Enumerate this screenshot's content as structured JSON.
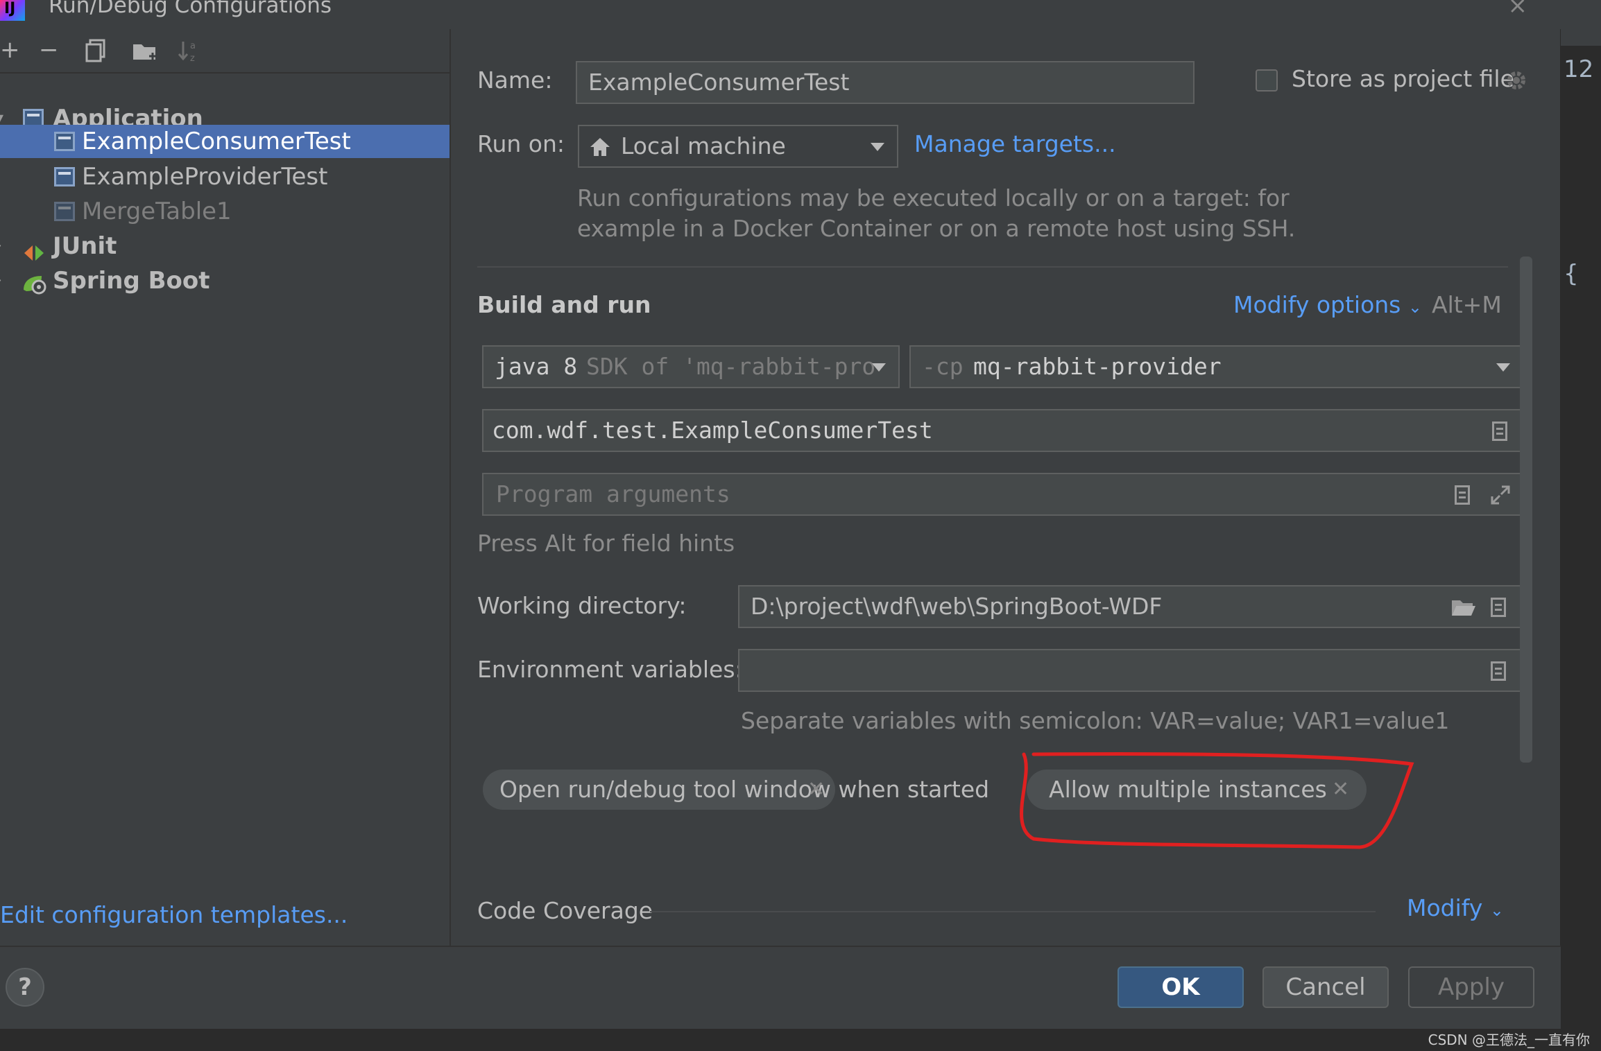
{
  "window": {
    "title": "Run/Debug Configurations"
  },
  "toolbar": {
    "add": "+",
    "remove": "−",
    "copy_icon": "copy-icon",
    "folder_icon": "new-folder-icon",
    "sort_icon": "sort-icon"
  },
  "tree": {
    "items": [
      {
        "label": "Application",
        "icon": "application-icon",
        "bold": true
      },
      {
        "label": "ExampleConsumerTest",
        "icon": "application-icon",
        "selected": true
      },
      {
        "label": "ExampleProviderTest",
        "icon": "application-icon"
      },
      {
        "label": "MergeTable1",
        "icon": "application-icon",
        "dimmed": true
      },
      {
        "label": "JUnit",
        "icon": "junit-icon",
        "bold": true
      },
      {
        "label": "Spring Boot",
        "icon": "spring-boot-icon",
        "bold": true
      }
    ]
  },
  "edit_templates": "Edit configuration templates...",
  "form": {
    "name_label": "Name:",
    "name_value": "ExampleConsumerTest",
    "store_label": "Store as project file",
    "run_on_label": "Run on:",
    "run_on_value": "Local machine",
    "manage_targets": "Manage targets...",
    "run_on_hint_1": "Run configurations may be executed locally or on a target: for",
    "run_on_hint_2": "example in a Docker Container or on a remote host using SSH.",
    "build_run_title": "Build and run",
    "modify_options": "Modify options",
    "modify_shortcut": "Alt+M",
    "jdk_main": "java 8",
    "jdk_sub": "SDK of 'mq-rabbit-pro",
    "cp_prefix": "-cp",
    "cp_value": "mq-rabbit-provider",
    "main_class": "com.wdf.test.ExampleConsumerTest",
    "program_args_placeholder": "Program arguments",
    "field_hints": "Press Alt for field hints",
    "working_dir_label": "Working directory:",
    "working_dir_value": "D:\\project\\wdf\\web\\SpringBoot-WDF",
    "env_label": "Environment variables:",
    "env_value": "",
    "env_hint": "Separate variables with semicolon: VAR=value; VAR1=value1",
    "chips": [
      {
        "label": "Open run/debug tool window when started"
      },
      {
        "label": "Allow multiple instances"
      }
    ],
    "code_coverage": "Code Coverage",
    "modify": "Modify"
  },
  "buttons": {
    "help": "?",
    "ok": "OK",
    "cancel": "Cancel",
    "apply": "Apply"
  },
  "editor_peek": {
    "line_number": "12",
    "brace": "{"
  },
  "watermark": "CSDN @王德法_一直有你",
  "colors": {
    "accent_link": "#589df6",
    "selection": "#4b6eaf",
    "annotation": "#e02020",
    "ok_button": "#365880"
  }
}
